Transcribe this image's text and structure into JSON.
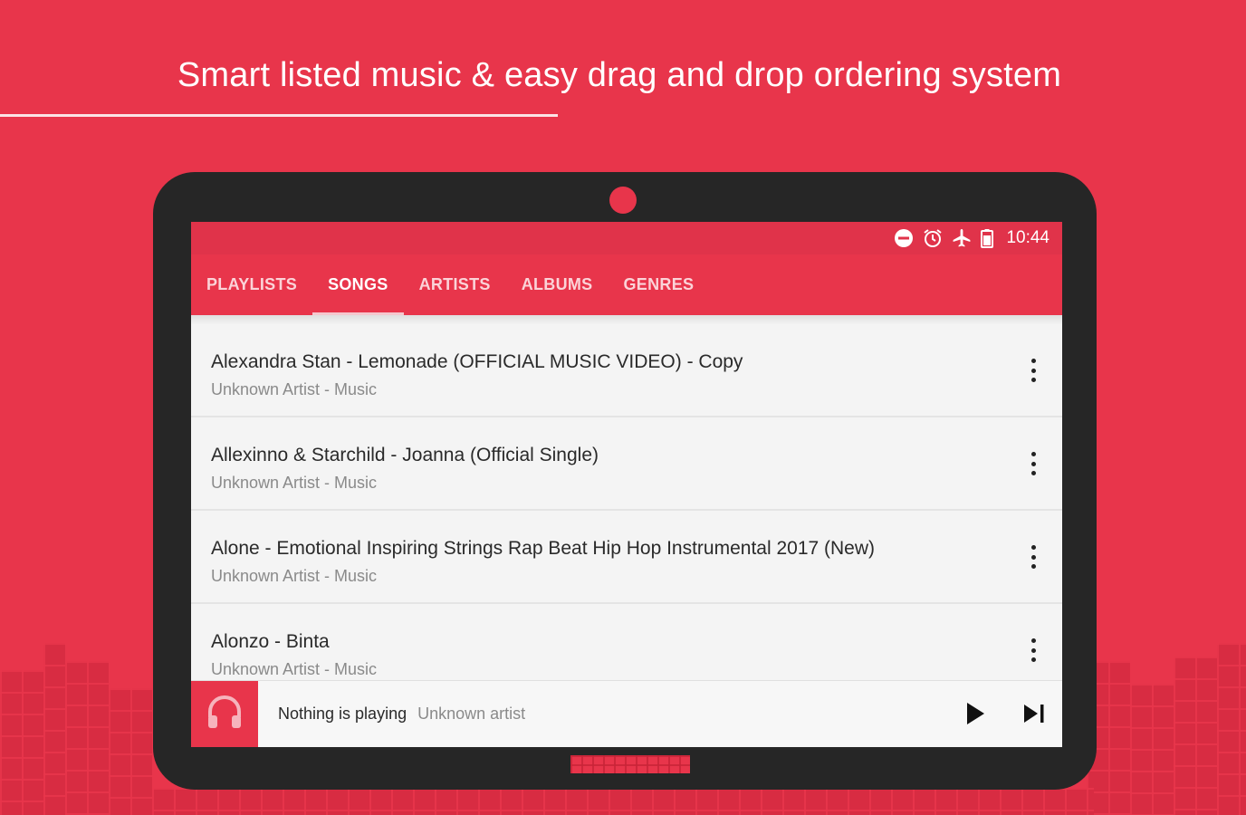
{
  "banner": {
    "headline": "Smart listed music & easy drag and drop ordering system"
  },
  "status_bar": {
    "time": "10:44",
    "icons": [
      "do-not-disturb-icon",
      "alarm-icon",
      "airplane-mode-icon",
      "battery-icon"
    ]
  },
  "tabs": [
    {
      "label": "PLAYLISTS",
      "active": false
    },
    {
      "label": "SONGS",
      "active": true
    },
    {
      "label": "ARTISTS",
      "active": false
    },
    {
      "label": "ALBUMS",
      "active": false
    },
    {
      "label": "GENRES",
      "active": false
    }
  ],
  "songs": [
    {
      "title": "Alexandra Stan - Lemonade (OFFICIAL MUSIC VIDEO) - Copy",
      "subtitle": "Unknown Artist - Music"
    },
    {
      "title": "Allexinno & Starchild - Joanna (Official Single)",
      "subtitle": "Unknown Artist - Music"
    },
    {
      "title": "Alone - Emotional Inspiring Strings Rap Beat Hip Hop Instrumental 2017 (New)",
      "subtitle": "Unknown Artist - Music"
    },
    {
      "title": "Alonzo - Binta",
      "subtitle": "Unknown Artist - Music"
    }
  ],
  "player": {
    "title": "Nothing is playing",
    "artist": "Unknown artist",
    "art_icon": "headphones-icon",
    "controls": [
      "play-icon",
      "skip-next-icon"
    ]
  },
  "colors": {
    "brand": "#e8354b",
    "tablet": "#262626",
    "list_background": "#f4f4f4"
  }
}
